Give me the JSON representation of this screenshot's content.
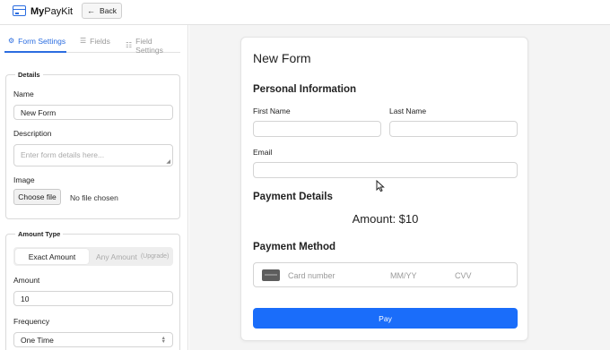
{
  "app": {
    "title_bold": "My",
    "title_rest": "PayKit",
    "logo_icon": "credit-card-icon"
  },
  "header": {
    "back_label": "Back",
    "back_icon": "arrow-left-icon"
  },
  "tabs": [
    {
      "label": "Form Settings",
      "icon": "gear-icon",
      "active": true
    },
    {
      "label": "Fields",
      "icon": "list-icon",
      "active": false
    },
    {
      "label": "Field Settings",
      "icon": "sliders-icon",
      "active": false
    }
  ],
  "details": {
    "legend": "Details",
    "name_label": "Name",
    "name_value": "New Form",
    "description_label": "Description",
    "description_placeholder": "Enter form details here...",
    "image_label": "Image",
    "file_button": "Choose file",
    "file_status": "No file chosen"
  },
  "amount_type": {
    "legend": "Amount Type",
    "options": [
      "Exact Amount",
      "Any Amount"
    ],
    "upgrade_tag": "(Upgrade)",
    "selected": "Exact Amount",
    "amount_label": "Amount",
    "amount_value": "10",
    "frequency_label": "Frequency",
    "frequency_value": "One Time"
  },
  "preview": {
    "form_title": "New Form",
    "personal_title": "Personal Information",
    "first_name_label": "First Name",
    "last_name_label": "Last Name",
    "email_label": "Email",
    "payment_details_title": "Payment Details",
    "amount_text": "Amount: $10",
    "payment_method_title": "Payment Method",
    "card_number_placeholder": "Card number",
    "expiry_placeholder": "MM/YY",
    "cvv_placeholder": "CVV",
    "pay_label": "Pay"
  },
  "colors": {
    "accent": "#2b6de0",
    "pay_button": "#1a6dfa"
  }
}
